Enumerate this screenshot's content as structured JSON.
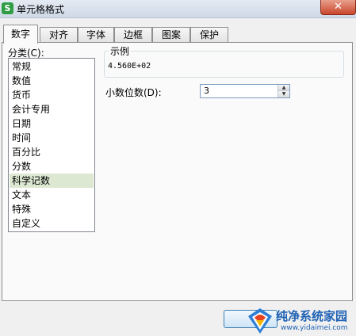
{
  "window": {
    "title": "单元格格式",
    "app_icon_label": "S",
    "close_label": "✕"
  },
  "tabs": [
    {
      "label": "数字",
      "active": true
    },
    {
      "label": "对齐",
      "active": false
    },
    {
      "label": "字体",
      "active": false
    },
    {
      "label": "边框",
      "active": false
    },
    {
      "label": "图案",
      "active": false
    },
    {
      "label": "保护",
      "active": false
    }
  ],
  "category": {
    "label": "分类(C):",
    "items": [
      "常规",
      "数值",
      "货币",
      "会计专用",
      "日期",
      "时间",
      "百分比",
      "分数",
      "科学记数",
      "文本",
      "特殊",
      "自定义"
    ],
    "selected": "科学记数"
  },
  "sample": {
    "title": "示例",
    "value": "4.560E+02"
  },
  "decimals": {
    "label": "小数位数(D):",
    "value": "3"
  },
  "watermark": {
    "title": "纯净系统家园",
    "url": "www.yidaimei.com"
  },
  "colors": {
    "selected_bg": "#dce8d2",
    "accent": "#1f62b5",
    "close": "#c9452b"
  }
}
